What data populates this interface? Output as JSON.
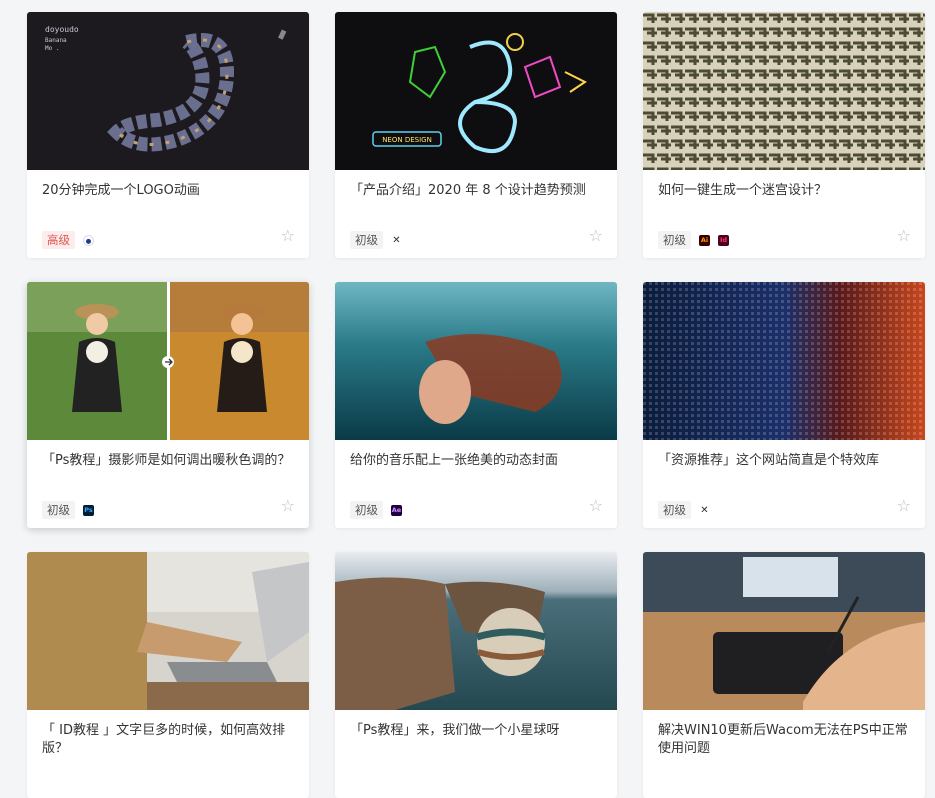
{
  "cards": [
    {
      "title": "20分钟完成一个LOGO动画",
      "level": "高级",
      "thumb_text": [
        "doyoudo",
        "Banana",
        "Mo ."
      ],
      "tools": [
        {
          "icon": "cinema4d-icon",
          "color": "#1c3e8c",
          "label": "C4"
        }
      ]
    },
    {
      "title": "「产品介绍」2020 年 8 个设计趋势预测",
      "level": "初级",
      "thumb_text": [
        "NEON DESIGN"
      ],
      "tools": [
        {
          "icon": "tools-icon",
          "color": "#333333",
          "label": "✕"
        }
      ]
    },
    {
      "title": "如何一键生成一个迷宫设计？",
      "level": "初级",
      "tools": [
        {
          "icon": "illustrator-icon",
          "color": "#330000",
          "label": "Ai"
        },
        {
          "icon": "indesign-icon",
          "color": "#49021f",
          "label": "Id"
        }
      ]
    },
    {
      "title": "「Ps教程」摄影师是如何调出暖秋色调的？",
      "level": "初级",
      "tools": [
        {
          "icon": "photoshop-icon",
          "color": "#001e36",
          "label": "Ps"
        }
      ]
    },
    {
      "title": "给你的音乐配上一张绝美的动态封面",
      "level": "初级",
      "tools": [
        {
          "icon": "after-effects-icon",
          "color": "#1f0040",
          "label": "Ae"
        }
      ]
    },
    {
      "title": "「资源推荐」这个网站简直是个特效库",
      "level": "初级",
      "tools": [
        {
          "icon": "tools-icon",
          "color": "#333333",
          "label": "✕"
        }
      ]
    },
    {
      "title": "「 ID教程 」文字巨多的时候，如何高效排版？",
      "level": "",
      "tools": []
    },
    {
      "title": "「Ps教程」来，我们做一个小星球呀",
      "level": "",
      "tools": []
    },
    {
      "title": "解决WIN10更新后Wacom无法在PS中正常使用问题",
      "level": "",
      "tools": []
    }
  ],
  "colors": {
    "advanced": "#e0574f",
    "star": "#bdbdbd"
  }
}
